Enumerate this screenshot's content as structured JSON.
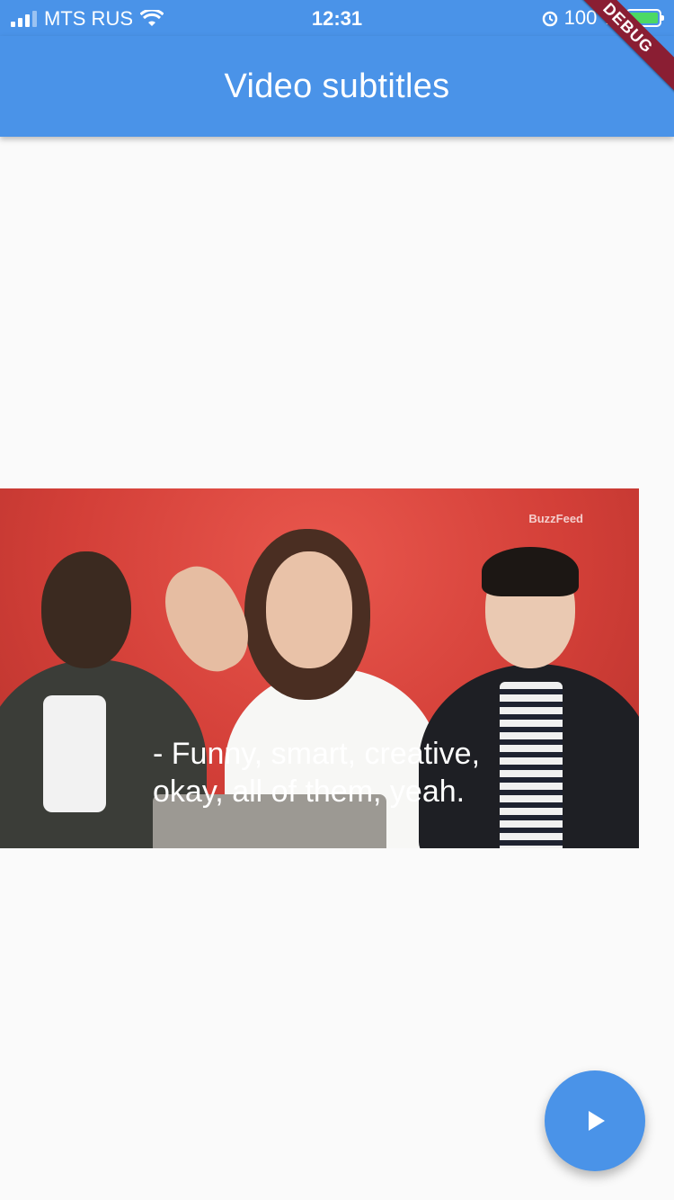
{
  "status_bar": {
    "carrier": "MTS RUS",
    "time": "12:31",
    "battery": "100 %",
    "icons": [
      "signal-icon",
      "wifi-icon",
      "alarm-icon",
      "battery-charging-icon"
    ]
  },
  "debug_banner": "DEBUG",
  "app_bar": {
    "title": "Video subtitles"
  },
  "video": {
    "watermark": "BuzzFeed",
    "subtitle_line1": "- Funny, smart, creative,",
    "subtitle_line2": "okay, all of them, yeah."
  },
  "fab": {
    "icon": "play-icon"
  },
  "colors": {
    "primary": "#4a93e8",
    "background": "#fafafa",
    "debug": "#8a1e33"
  }
}
